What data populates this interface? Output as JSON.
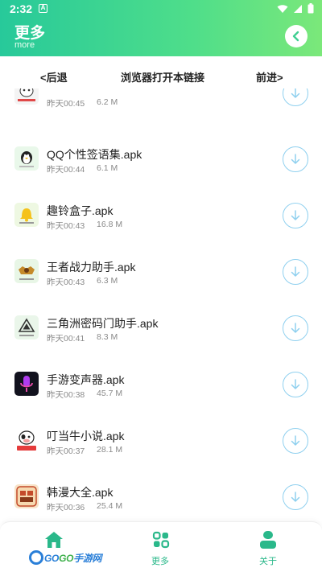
{
  "status_bar": {
    "time": "2:32",
    "notification_glyph": "A"
  },
  "header": {
    "title": "更多",
    "subtitle": "more"
  },
  "browser_bar": {
    "back": "<后退",
    "open": "浏览器打开本链接",
    "forward": "前进>"
  },
  "items": [
    {
      "name": "",
      "time": "昨天00:45",
      "size": "6.2 M",
      "icon": "cow-icon"
    },
    {
      "name": "QQ个性签语集.apk",
      "time": "昨天00:44",
      "size": "6.1 M",
      "icon": "penguin-icon"
    },
    {
      "name": "趣铃盒子.apk",
      "time": "昨天00:43",
      "size": "16.8 M",
      "icon": "bell-icon"
    },
    {
      "name": "王者战力助手.apk",
      "time": "昨天00:43",
      "size": "6.3 M",
      "icon": "king-emblem-icon"
    },
    {
      "name": "三角洲密码门助手.apk",
      "time": "昨天00:41",
      "size": "8.3 M",
      "icon": "delta-triangle-icon"
    },
    {
      "name": "手游变声器.apk",
      "time": "昨天00:38",
      "size": "45.7 M",
      "icon": "microphone-icon"
    },
    {
      "name": "叮当牛小说.apk",
      "time": "昨天00:37",
      "size": "28.1 M",
      "icon": "cow-book-icon"
    },
    {
      "name": "韩漫大全.apk",
      "time": "昨天00:36",
      "size": "25.4 M",
      "icon": "comic-icon"
    }
  ],
  "bottom_nav": {
    "more": "更多",
    "about": "关于"
  },
  "watermark": {
    "part1": "GO",
    "part2": "GO",
    "part3": "手游网"
  },
  "colors": {
    "accent": "#2ab88a",
    "header_start": "#27c99a",
    "header_end": "#7be87a",
    "download_ring": "#8fd0ef"
  }
}
